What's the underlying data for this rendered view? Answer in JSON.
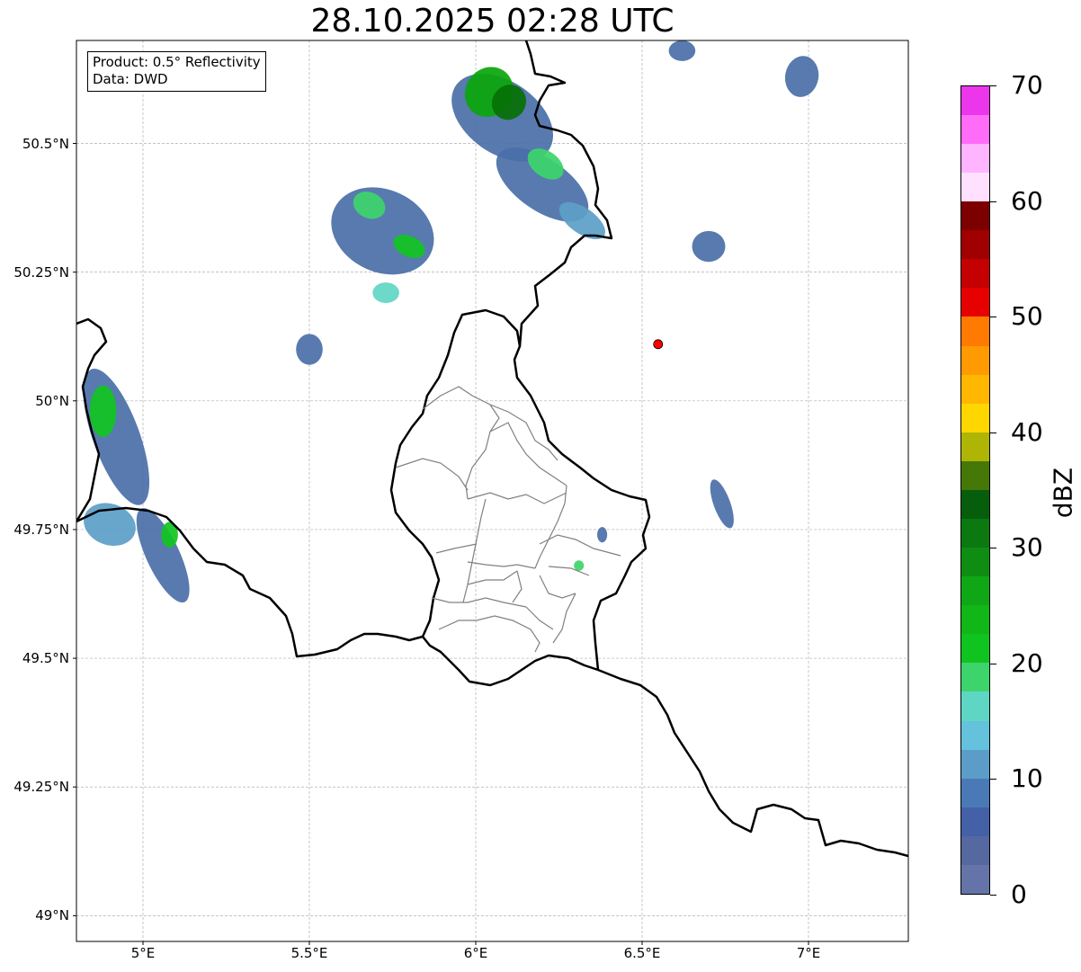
{
  "title": "28.10.2025 02:28 UTC",
  "info_box": {
    "product": "Product: 0.5° Reflectivity",
    "source": "Data: DWD"
  },
  "map": {
    "lon_ticks": [
      {
        "value": 5.0,
        "label": "5°E"
      },
      {
        "value": 5.5,
        "label": "5.5°E"
      },
      {
        "value": 6.0,
        "label": "6°E"
      },
      {
        "value": 6.5,
        "label": "6.5°E"
      },
      {
        "value": 7.0,
        "label": "7°E"
      }
    ],
    "lat_ticks": [
      {
        "value": 49.0,
        "label": "49°N"
      },
      {
        "value": 49.25,
        "label": "49.25°N"
      },
      {
        "value": 49.5,
        "label": "49.5°N"
      },
      {
        "value": 49.75,
        "label": "49.75°N"
      },
      {
        "value": 50.0,
        "label": "50°N"
      },
      {
        "value": 50.25,
        "label": "50.25°N"
      },
      {
        "value": 50.5,
        "label": "50.5°N"
      }
    ],
    "extent": {
      "lon_min": 4.8,
      "lon_max": 7.3,
      "lat_min": 48.95,
      "lat_max": 50.7
    },
    "radar_site": {
      "lon": 6.548,
      "lat": 50.11,
      "color": "#ff0000"
    },
    "echoes": [
      {
        "lon": 6.08,
        "lat": 50.55,
        "rlon": 0.17,
        "rlat": 0.07,
        "rot": 35,
        "color": "#4a6fa8"
      },
      {
        "lon": 6.2,
        "lat": 50.42,
        "rlon": 0.16,
        "rlat": 0.05,
        "rot": 35,
        "color": "#4a6fa8"
      },
      {
        "lon": 6.04,
        "lat": 50.6,
        "rlon": 0.07,
        "rlat": 0.05,
        "rot": 35,
        "color": "#0aa50a"
      },
      {
        "lon": 6.1,
        "lat": 50.58,
        "rlon": 0.05,
        "rlat": 0.035,
        "rot": 35,
        "color": "#067006"
      },
      {
        "lon": 6.21,
        "lat": 50.46,
        "rlon": 0.06,
        "rlat": 0.025,
        "rot": 35,
        "color": "#3dd46b"
      },
      {
        "lon": 6.32,
        "lat": 50.35,
        "rlon": 0.08,
        "rlat": 0.025,
        "rot": 35,
        "color": "#5c9ec7"
      },
      {
        "lon": 5.72,
        "lat": 50.33,
        "rlon": 0.16,
        "rlat": 0.08,
        "rot": 25,
        "color": "#4a6fa8"
      },
      {
        "lon": 5.68,
        "lat": 50.38,
        "rlon": 0.05,
        "rlat": 0.025,
        "rot": 25,
        "color": "#3dd46b"
      },
      {
        "lon": 5.8,
        "lat": 50.3,
        "rlon": 0.05,
        "rlat": 0.02,
        "rot": 25,
        "color": "#10c420"
      },
      {
        "lon": 5.73,
        "lat": 50.21,
        "rlon": 0.04,
        "rlat": 0.02,
        "rot": 0,
        "color": "#5fd6c4"
      },
      {
        "lon": 5.5,
        "lat": 50.1,
        "rlon": 0.04,
        "rlat": 0.03,
        "rot": 0,
        "color": "#4a6fa8"
      },
      {
        "lon": 4.92,
        "lat": 49.93,
        "rlon": 0.07,
        "rlat": 0.14,
        "rot": -20,
        "color": "#4a6fa8"
      },
      {
        "lon": 4.88,
        "lat": 49.98,
        "rlon": 0.04,
        "rlat": 0.05,
        "rot": 0,
        "color": "#10c420"
      },
      {
        "lon": 4.9,
        "lat": 49.76,
        "rlon": 0.08,
        "rlat": 0.04,
        "rot": 20,
        "color": "#5c9ec7"
      },
      {
        "lon": 5.06,
        "lat": 49.7,
        "rlon": 0.05,
        "rlat": 0.1,
        "rot": -25,
        "color": "#4a6fa8"
      },
      {
        "lon": 5.08,
        "lat": 49.74,
        "rlon": 0.025,
        "rlat": 0.025,
        "rot": 0,
        "color": "#10c420"
      },
      {
        "lon": 6.98,
        "lat": 50.63,
        "rlon": 0.05,
        "rlat": 0.04,
        "rot": 10,
        "color": "#4a6fa8"
      },
      {
        "lon": 6.74,
        "lat": 49.8,
        "rlon": 0.025,
        "rlat": 0.05,
        "rot": -20,
        "color": "#4a6fa8"
      },
      {
        "lon": 6.62,
        "lat": 50.68,
        "rlon": 0.04,
        "rlat": 0.02,
        "rot": 0,
        "color": "#4a6fa8"
      },
      {
        "lon": 6.7,
        "lat": 50.3,
        "rlon": 0.05,
        "rlat": 0.03,
        "rot": 0,
        "color": "#4a6fa8"
      },
      {
        "lon": 6.38,
        "lat": 49.74,
        "rlon": 0.015,
        "rlat": 0.015,
        "rot": 0,
        "color": "#4a6fa8"
      },
      {
        "lon": 6.31,
        "lat": 49.68,
        "rlon": 0.015,
        "rlat": 0.01,
        "rot": 0,
        "color": "#3dd46b"
      }
    ]
  },
  "colorbar": {
    "label": "dBZ",
    "min": 0,
    "max": 70,
    "step": 2.5,
    "tick_values": [
      0,
      10,
      20,
      30,
      40,
      50,
      60,
      70
    ],
    "colors": [
      "#6574a8",
      "#5568a0",
      "#4460a6",
      "#4a7ab5",
      "#5b9dc8",
      "#64c2dc",
      "#5fd6c4",
      "#3dd46b",
      "#10c420",
      "#11b617",
      "#10a716",
      "#0e8d12",
      "#0b7810",
      "#065e0c",
      "#467808",
      "#aeb505",
      "#ffd700",
      "#ffb700",
      "#ff9a00",
      "#ff7a00",
      "#e60000",
      "#c40000",
      "#a00000",
      "#7d0000",
      "#ffe0ff",
      "#ffb4ff",
      "#ff6cf8",
      "#ec36ec"
    ]
  }
}
